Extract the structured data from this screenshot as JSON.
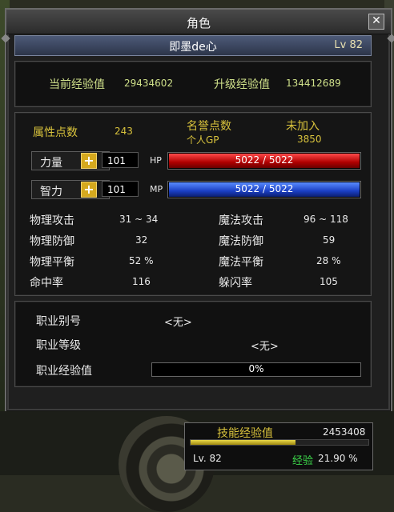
{
  "window": {
    "title": "角色",
    "close_label": "✕"
  },
  "character": {
    "name": "即墨de心",
    "level": "Lv 82"
  },
  "experience": {
    "current_label": "当前经验值",
    "current_value": "29434602",
    "next_label": "升级经验值",
    "next_value": "134412689"
  },
  "attributes": {
    "points_label": "属性点数",
    "points_value": "243",
    "honor_label": "名誉点数",
    "honor_value": "未加入",
    "gp_label": "个人GP",
    "gp_value": "3850",
    "str_label": "力量",
    "str_value": "101",
    "int_label": "智力",
    "int_value": "101",
    "hp_label": "HP",
    "hp_text": "5022 / 5022",
    "hp_fraction": 1.0,
    "mp_label": "MP",
    "mp_text": "5022 / 5022",
    "mp_fraction": 1.0
  },
  "stats": {
    "phys_atk_label": "物理攻击",
    "phys_atk_value": "31 ~ 34",
    "mag_atk_label": "魔法攻击",
    "mag_atk_value": "96 ~ 118",
    "phys_def_label": "物理防御",
    "phys_def_value": "32",
    "mag_def_label": "魔法防御",
    "mag_def_value": "59",
    "phys_bal_label": "物理平衡",
    "phys_bal_value": "52 %",
    "mag_bal_label": "魔法平衡",
    "mag_bal_value": "28 %",
    "hit_label": "命中率",
    "hit_value": "116",
    "dodge_label": "躲闪率",
    "dodge_value": "105"
  },
  "job": {
    "alias_label": "职业别号",
    "alias_value": "<无>",
    "level_label": "职业等级",
    "level_value": "<无>",
    "exp_label": "职业经验值",
    "exp_text": "0%",
    "exp_fraction": 0.0
  },
  "skill": {
    "label": "技能经验值",
    "value": "2453408",
    "exp_fraction": 0.6,
    "level": "Lv.  82",
    "exp_label": "经验",
    "exp_percent": "21.90 %"
  },
  "colors": {
    "hp": "#d41010",
    "mp": "#2048d8",
    "label_yellow": "#d8c23c",
    "label_green": "#cfe08a"
  }
}
